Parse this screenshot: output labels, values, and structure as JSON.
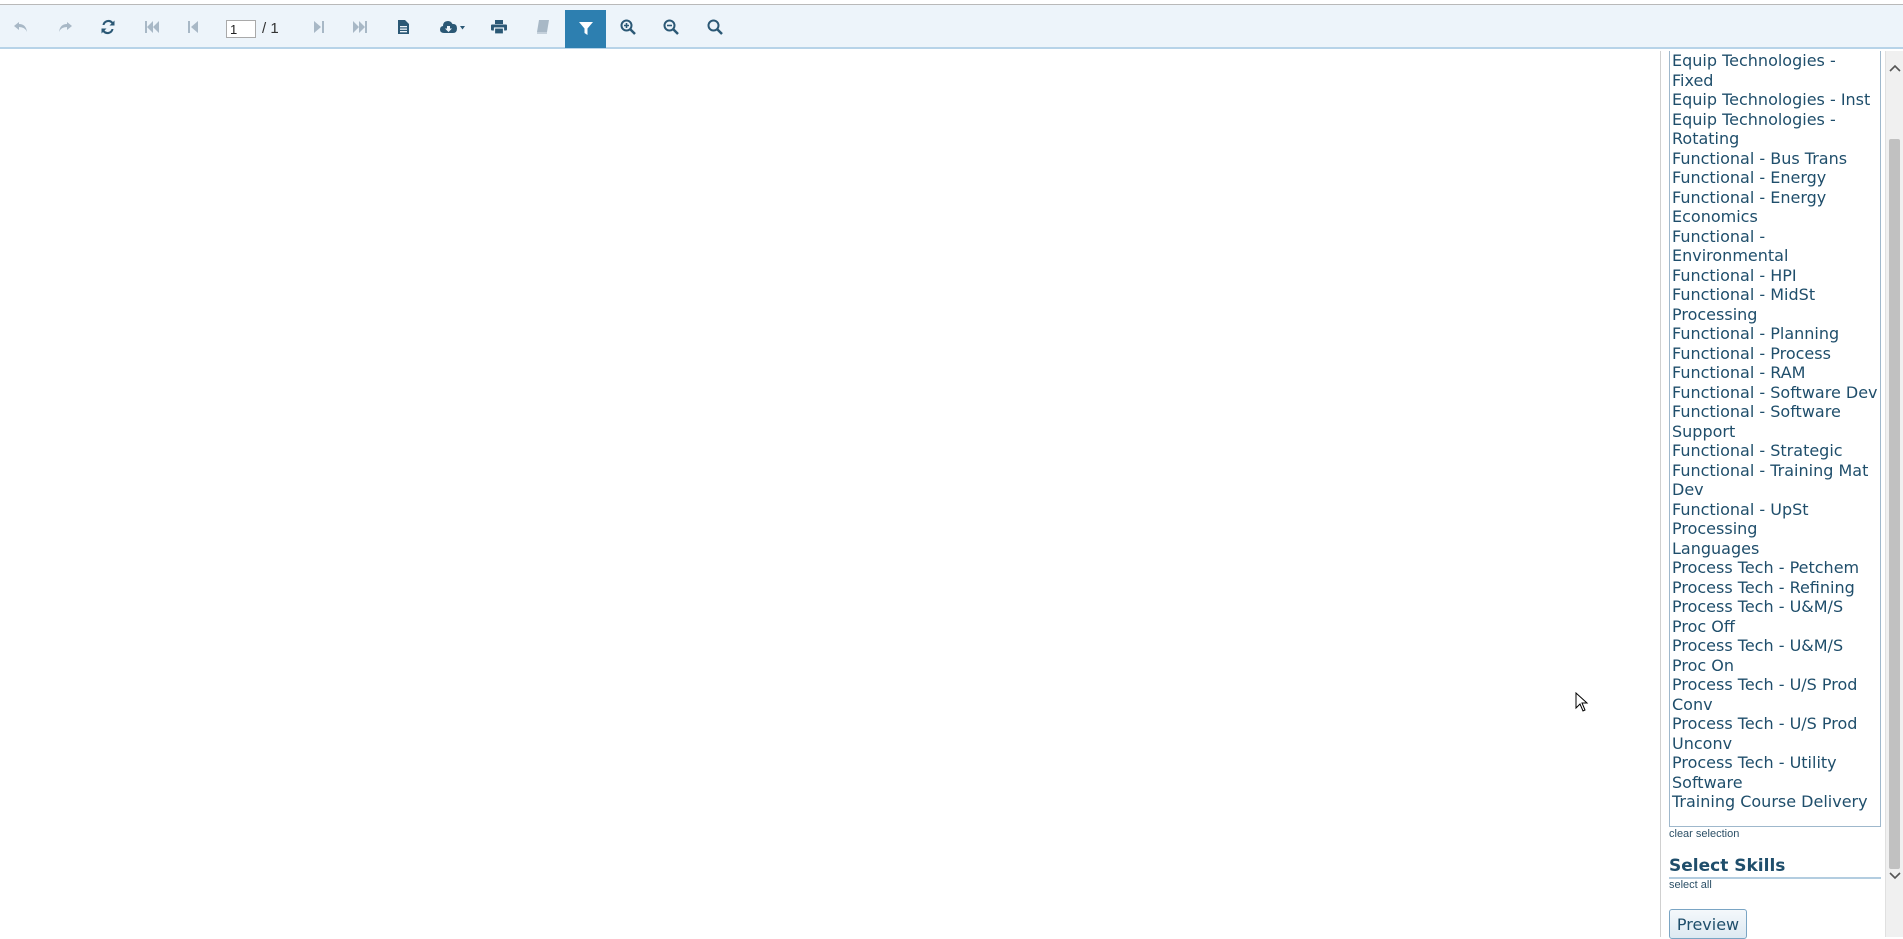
{
  "toolbar": {
    "current_page": "1",
    "page_total": "/ 1",
    "buttons": [
      {
        "name": "undo-icon",
        "enabled": false
      },
      {
        "name": "redo-icon",
        "enabled": false
      },
      {
        "name": "refresh-icon",
        "enabled": true
      },
      {
        "name": "first-page-icon",
        "enabled": false
      },
      {
        "name": "previous-page-icon",
        "enabled": false
      },
      {
        "name": "next-page-icon",
        "enabled": false
      },
      {
        "name": "last-page-icon",
        "enabled": false
      },
      {
        "name": "document-icon",
        "enabled": true
      },
      {
        "name": "cloud-download-icon",
        "enabled": true
      },
      {
        "name": "print-icon",
        "enabled": true
      },
      {
        "name": "book-icon",
        "enabled": false
      },
      {
        "name": "filter-icon",
        "enabled": true,
        "active": true
      },
      {
        "name": "zoom-in-icon",
        "enabled": true
      },
      {
        "name": "zoom-out-icon",
        "enabled": true
      },
      {
        "name": "search-icon",
        "enabled": true
      }
    ]
  },
  "panel": {
    "list_items": [
      "Equip Technologies - Fixed",
      "Equip Technologies - Inst",
      "Equip Technologies - Rotating",
      "Functional - Bus Trans",
      "Functional - Energy",
      "Functional - Energy Economics",
      "Functional - Environmental",
      "Functional - HPI",
      "Functional - MidSt Processing",
      "Functional - Planning",
      "Functional - Process",
      "Functional - RAM",
      "Functional - Software Dev",
      "Functional - Software Support",
      "Functional - Strategic",
      "Functional - Training Mat Dev",
      "Functional - UpSt Processing",
      "Languages",
      "Process Tech - Petchem",
      "Process Tech - Refining",
      "Process Tech - U&M/S Proc Off",
      "Process Tech - U&M/S Proc On",
      "Process Tech - U/S Prod Conv",
      "Process Tech - U/S Prod Unconv",
      "Process Tech - Utility Software",
      "Training Course Delivery"
    ],
    "clear_selection": "clear selection",
    "select_skills_title": "Select Skills",
    "select_all": "select all",
    "preview_label": "Preview"
  },
  "colors": {
    "toolbar_bg": "#edf4fa",
    "accent": "#2d7fb0",
    "text": "#1f4e6b"
  }
}
